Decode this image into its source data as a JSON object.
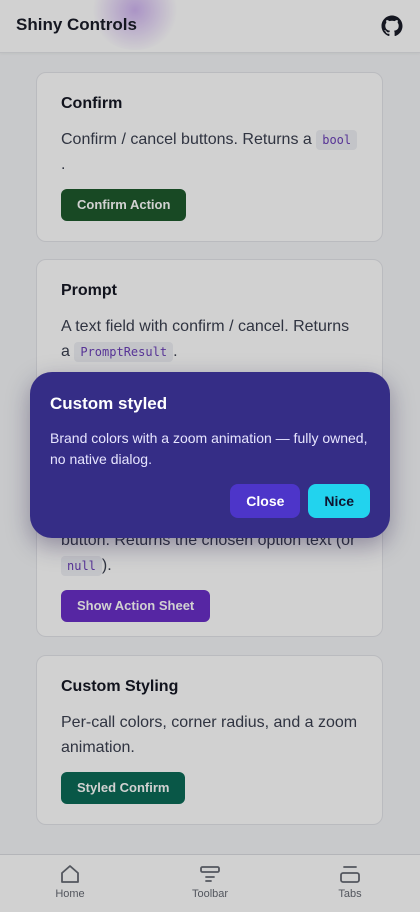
{
  "header": {
    "title": "Shiny Controls",
    "icon": "github-icon"
  },
  "cards": {
    "confirm": {
      "title": "Confirm",
      "desc": "Confirm / cancel buttons. Returns a",
      "code": "bool",
      "after_code": ".",
      "button": "Confirm Action",
      "button_color": "#1e5a2c"
    },
    "prompt": {
      "title": "Prompt",
      "desc": "A text field with confirm / cancel. Returns a",
      "code": "PromptResult",
      "after_code": "."
    },
    "action_sheet": {
      "desc_visible": "button. Returns the chosen option text (or",
      "code": "null",
      "after_code": ").",
      "button": "Show Action Sheet",
      "button_color": "#6a2fc7"
    },
    "custom": {
      "title": "Custom Styling",
      "desc": "Per-call colors, corner radius, and a zoom animation.",
      "button": "Styled Confirm",
      "button_color": "#0b6b57"
    }
  },
  "dialog": {
    "title": "Custom styled",
    "message": "Brand colors with a zoom animation — fully owned, no native dialog.",
    "cancel_label": "Close",
    "confirm_label": "Nice",
    "background": "#352d86",
    "cancel_color": "#4d35c9",
    "confirm_color": "#22d3ee"
  },
  "tabbar": {
    "items": [
      {
        "label": "Home",
        "icon": "home-icon"
      },
      {
        "label": "Toolbar",
        "icon": "toolbar-icon"
      },
      {
        "label": "Tabs",
        "icon": "tabs-icon"
      }
    ]
  }
}
